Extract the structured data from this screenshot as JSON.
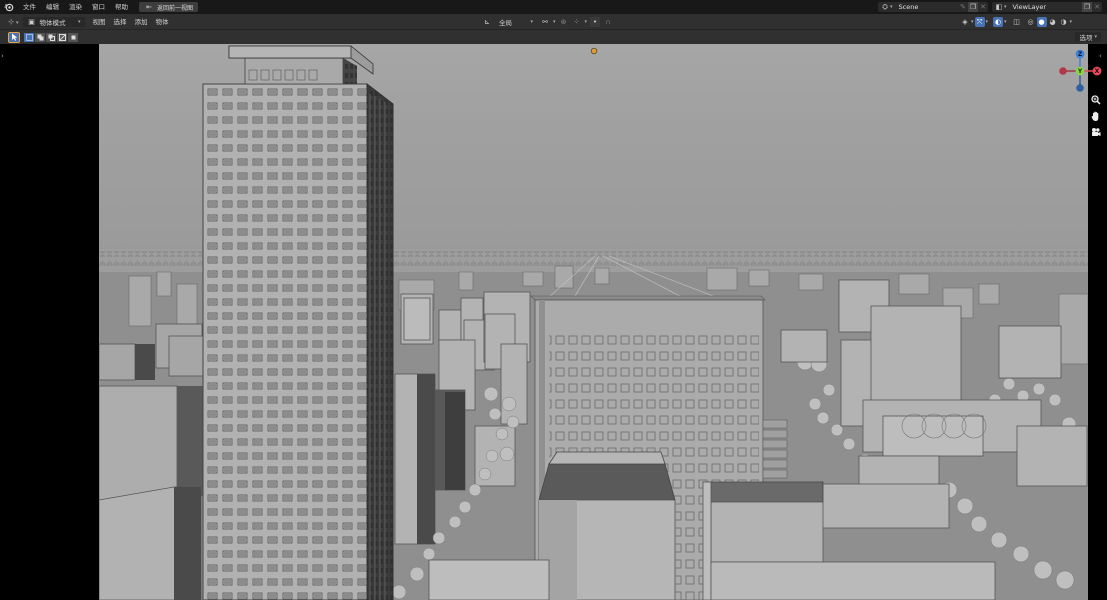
{
  "menubar": {
    "items": [
      "文件",
      "编辑",
      "渲染",
      "窗口",
      "帮助"
    ],
    "back_button": "返回前一视图"
  },
  "scene": {
    "label": "Scene"
  },
  "view_layer": {
    "label": "ViewLayer"
  },
  "header": {
    "mode_label": "物体模式",
    "menus": [
      "视图",
      "选择",
      "添加",
      "物体"
    ],
    "transform_orientation": "全局"
  },
  "toolbar": {
    "options_label": "选项"
  },
  "gizmo": {
    "x_label": "X",
    "y_label": "Y",
    "z_label": "Z",
    "colors": {
      "x": "#e84a5f",
      "y": "#8bd24a",
      "z": "#3f83dc"
    }
  },
  "colors": {
    "accent": "#4772b3",
    "active_outline": "#e9a44a",
    "viewport_bg": "#a3a3a3"
  }
}
